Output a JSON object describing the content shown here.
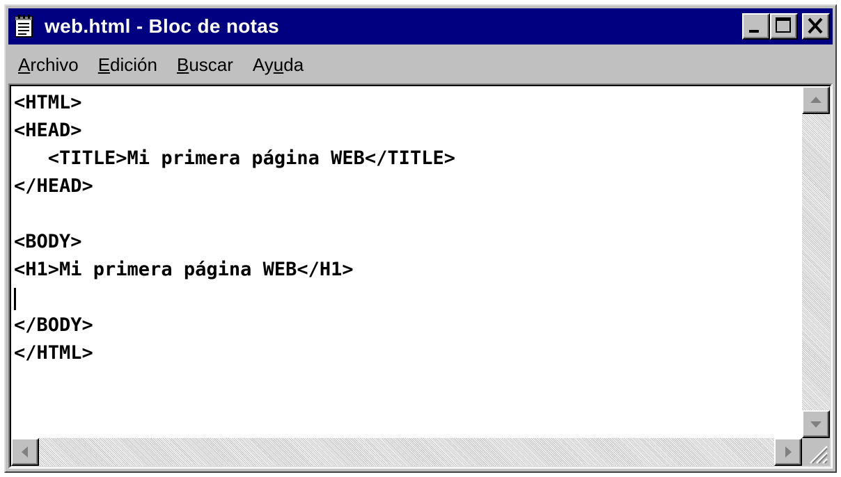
{
  "window": {
    "title": "web.html - Bloc de notas"
  },
  "menu": [
    {
      "pre": "",
      "acc": "A",
      "post": "rchivo"
    },
    {
      "pre": "",
      "acc": "E",
      "post": "dición"
    },
    {
      "pre": "",
      "acc": "B",
      "post": "uscar"
    },
    {
      "pre": "Ay",
      "acc": "u",
      "post": "da"
    }
  ],
  "editor": {
    "lines": [
      "<HTML>",
      "<HEAD>",
      "   <TITLE>Mi primera página WEB</TITLE>",
      "</HEAD>",
      "",
      "<BODY>",
      "<H1>Mi primera página WEB</H1>",
      "",
      "</BODY>",
      "</HTML>"
    ]
  },
  "icons": {
    "app": "notepad-icon",
    "minimize": "minimize-icon",
    "maximize": "maximize-icon",
    "close": "close-icon",
    "scroll_up": "arrow-up-icon",
    "scroll_down": "arrow-down-icon",
    "scroll_left": "arrow-left-icon",
    "scroll_right": "arrow-right-icon",
    "resize_grip": "resize-grip-icon"
  },
  "colors": {
    "titlebar": "#000080",
    "face": "#c0c0c0",
    "text_bg": "#ffffff"
  }
}
